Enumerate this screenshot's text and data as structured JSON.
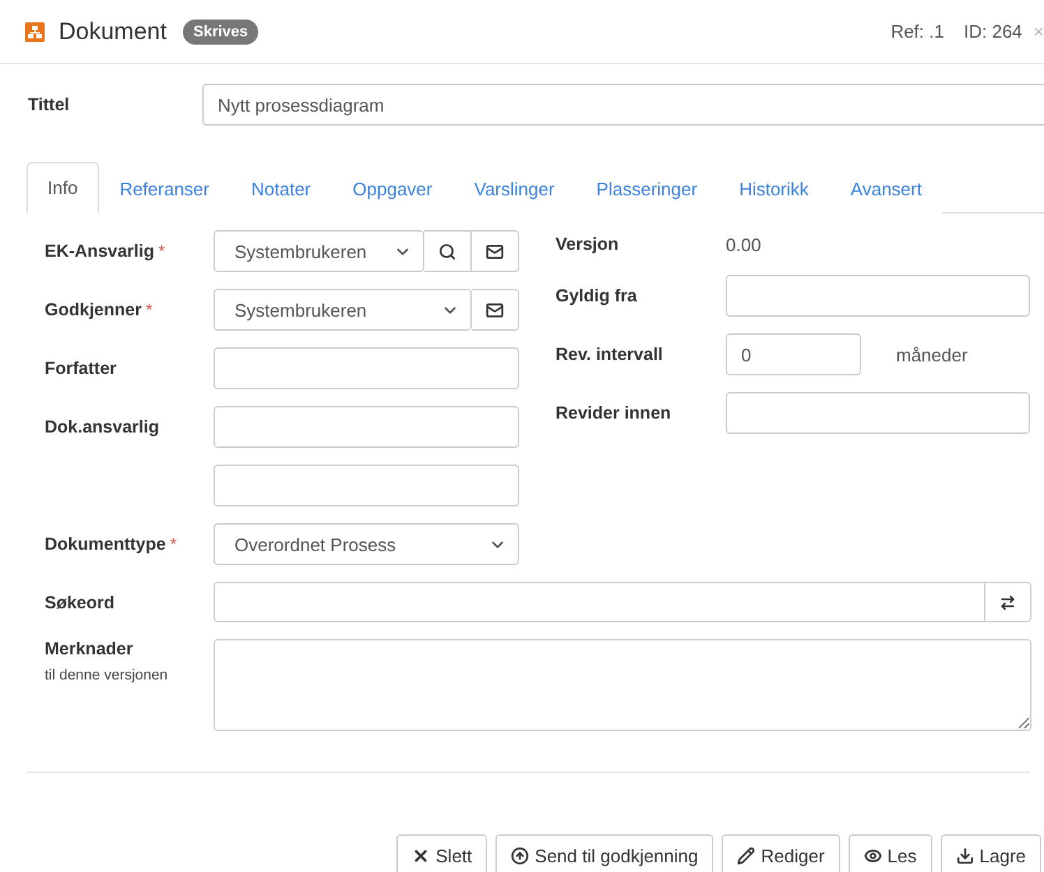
{
  "header": {
    "title": "Dokument",
    "status": "Skrives",
    "ref": "Ref: .1",
    "id": "ID: 264",
    "close": "×"
  },
  "title_field": {
    "label": "Tittel",
    "value": "Nytt prosessdiagram"
  },
  "tabs": [
    {
      "label": "Info",
      "selected": true
    },
    {
      "label": "Referanser",
      "selected": false
    },
    {
      "label": "Notater",
      "selected": false
    },
    {
      "label": "Oppgaver",
      "selected": false
    },
    {
      "label": "Varslinger",
      "selected": false
    },
    {
      "label": "Plasseringer",
      "selected": false
    },
    {
      "label": "Historikk",
      "selected": false
    },
    {
      "label": "Avansert",
      "selected": false
    }
  ],
  "left_fields": [
    {
      "kind": "select",
      "label": "EK-Ansvarlig",
      "required_mark": "*",
      "value": "Systembrukeren",
      "search_button": true,
      "mail_button": true
    },
    {
      "kind": "select",
      "label": "Godkjenner",
      "required_mark": "*",
      "value": "Systembrukeren",
      "search_button": false,
      "mail_button": true
    },
    {
      "kind": "input",
      "label": "Forfatter"
    },
    {
      "kind": "input",
      "label": "Dok.ansvarlig"
    },
    {
      "kind": "input"
    },
    {
      "kind": "select",
      "label": "Dokumenttype",
      "required_mark": "*",
      "value": "Overordnet Prosess",
      "search_button": false,
      "mail_button": false
    }
  ],
  "right_fields": [
    {
      "kind": "text",
      "label": "Versjon",
      "value": "0.00"
    },
    {
      "kind": "input",
      "label": "Gyldig fra"
    },
    {
      "kind": "input",
      "label": "Rev. intervall",
      "value": "0",
      "suffix": "måneder"
    },
    {
      "kind": "input",
      "label": "Revider innen"
    }
  ],
  "keywords": {
    "label": "Søkeord"
  },
  "notes": {
    "label": "Merknader",
    "hint": "til denne versjonen"
  },
  "buttons": [
    {
      "label": "Slett"
    },
    {
      "label": "Send til godkjenning"
    },
    {
      "label": "Rediger"
    },
    {
      "label": "Les"
    },
    {
      "label": "Lagre"
    }
  ]
}
